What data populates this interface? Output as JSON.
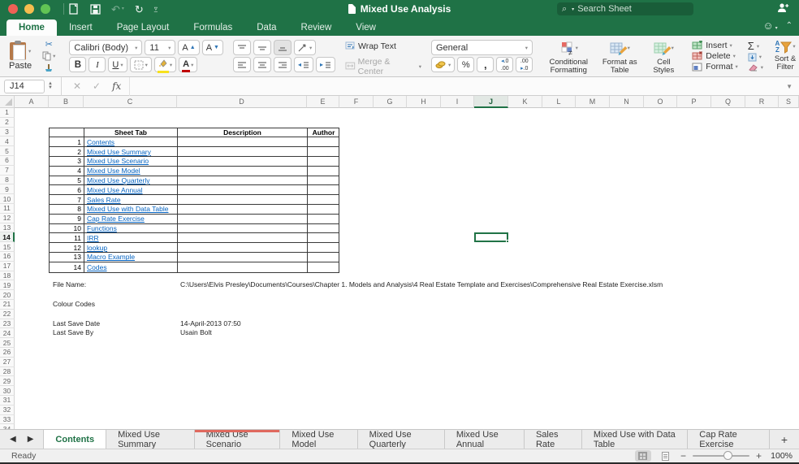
{
  "window": {
    "title": "Mixed Use Analysis"
  },
  "titlebar": {
    "search_placeholder": "Search Sheet"
  },
  "ribbon_tabs": [
    {
      "label": "Home",
      "active": true
    },
    {
      "label": "Insert",
      "active": false
    },
    {
      "label": "Page Layout",
      "active": false
    },
    {
      "label": "Formulas",
      "active": false
    },
    {
      "label": "Data",
      "active": false
    },
    {
      "label": "Review",
      "active": false
    },
    {
      "label": "View",
      "active": false
    }
  ],
  "ribbon": {
    "paste_label": "Paste",
    "font_name": "Calibri (Body)",
    "font_size": "11",
    "bold": "B",
    "italic": "I",
    "underline": "U",
    "wrap_text_label": "Wrap Text",
    "merge_center_label": "Merge & Center",
    "number_format": "General",
    "percent": "%",
    "comma": ",",
    "conditional_formatting_label": "Conditional Formatting",
    "format_as_table_label": "Format as Table",
    "cell_styles_label": "Cell Styles",
    "insert_label": "Insert",
    "delete_label": "Delete",
    "format_label": "Format",
    "autosum_label": "Σ",
    "sort_filter_label": "Sort & Filter"
  },
  "formula_bar": {
    "name_box": "J14",
    "fx_label": "fx",
    "formula_value": ""
  },
  "grid": {
    "columns": [
      "A",
      "B",
      "C",
      "D",
      "E",
      "F",
      "G",
      "H",
      "I",
      "J",
      "K",
      "L",
      "M",
      "N",
      "O",
      "P",
      "Q",
      "R",
      "S"
    ],
    "selected_column": "J",
    "selected_row": 14,
    "visible_rows": 34,
    "selected_cell_ref": "J14"
  },
  "sheet_table": {
    "headers": [
      "Sheet Tab",
      "Description",
      "Author"
    ],
    "rows": [
      {
        "num": "1",
        "name": "Contents"
      },
      {
        "num": "2",
        "name": "Mixed Use Summary"
      },
      {
        "num": "3",
        "name": "Mixed Use Scenario"
      },
      {
        "num": "4",
        "name": "Mixed Use Model"
      },
      {
        "num": "5",
        "name": "Mixed Use Quarterly"
      },
      {
        "num": "6",
        "name": "Mixed Use Annual"
      },
      {
        "num": "7",
        "name": "Sales Rate"
      },
      {
        "num": "8",
        "name": "Mixed Use with Data Table"
      },
      {
        "num": "9",
        "name": "Cap Rate Exercise"
      },
      {
        "num": "10",
        "name": "Functions"
      },
      {
        "num": "11",
        "name": "IRR"
      },
      {
        "num": "12",
        "name": "lookup"
      },
      {
        "num": "13",
        "name": "Macro Example"
      },
      {
        "num": "14",
        "name": "Codes"
      }
    ]
  },
  "info": {
    "file_name_label": "File Name:",
    "file_name_value": "C:\\Users\\Elvis Presley\\Documents\\Courses\\Chapter 1. Models and Analysis\\4 Real Estate Template and Exercises\\Comprehensive Real Estate Exercise.xlsm",
    "colour_codes_label": "Colour Codes",
    "last_save_date_label": "Last Save Date",
    "last_save_date_value": "14-April-2013 07:50",
    "last_save_by_label": "Last Save By",
    "last_save_by_value": "Usain Bolt"
  },
  "sheet_tabs": [
    {
      "label": "Contents",
      "active": true
    },
    {
      "label": "Mixed Use Summary",
      "active": false
    },
    {
      "label": "Mixed Use Scenario",
      "active": false,
      "color_bar": "#e0695f"
    },
    {
      "label": "Mixed Use Model",
      "active": false
    },
    {
      "label": "Mixed Use Quarterly",
      "active": false
    },
    {
      "label": "Mixed Use Annual",
      "active": false
    },
    {
      "label": "Sales Rate",
      "active": false
    },
    {
      "label": "Mixed Use with Data Table",
      "active": false
    },
    {
      "label": "Cap Rate Exercise",
      "active": false
    }
  ],
  "status_bar": {
    "status": "Ready",
    "zoom_level": "100%"
  },
  "colors": {
    "brand_green": "#1f7246",
    "hyperlink": "#0563c1",
    "scenario_tab_bar": "#e0695f"
  }
}
